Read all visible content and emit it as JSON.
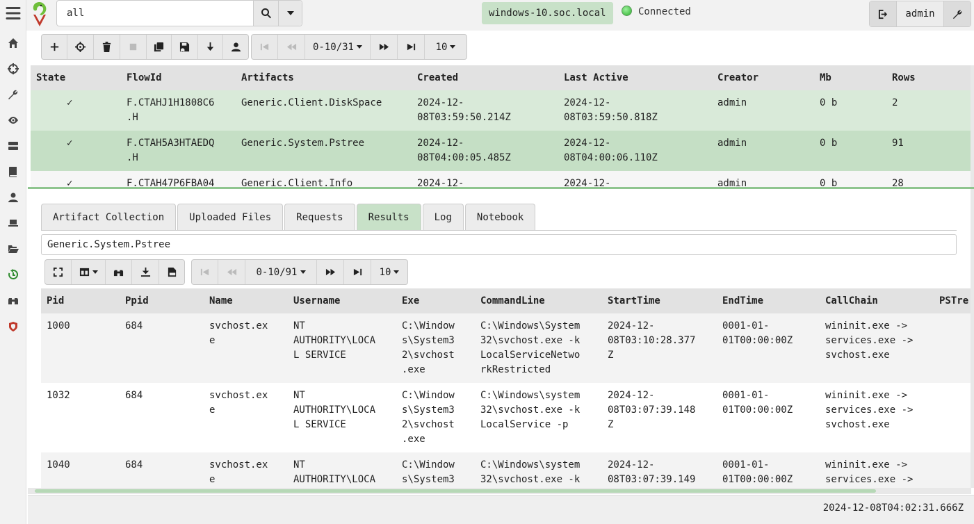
{
  "sidebar": {
    "icons": [
      "hamburger-icon",
      "home-icon",
      "crosshair-icon",
      "wrench-icon",
      "eye-icon",
      "server-icon",
      "book-icon",
      "user-icon",
      "laptop-icon",
      "folder-open-icon",
      "history-icon",
      "binoculars-icon",
      "velociraptor-shield-icon"
    ]
  },
  "header": {
    "search_value": "all",
    "host": "windows-10.soc.local",
    "connection_status": "Connected",
    "user": "admin"
  },
  "flows_toolbar": {
    "page_range": "0-10/31",
    "page_size": "10"
  },
  "flows": {
    "columns": [
      "State",
      "FlowId",
      "Artifacts",
      "Created",
      "Last Active",
      "Creator",
      "Mb",
      "Rows"
    ],
    "rows": [
      {
        "state": "✓",
        "flow_id": "F.CTAHJ1H1808C6\n.H",
        "artifacts": "Generic.Client.DiskSpace",
        "created": "2024-12-\n08T03:59:50.214Z",
        "last_active": "2024-12-\n08T03:59:50.818Z",
        "creator": "admin",
        "mb": "0 b",
        "rows": "2"
      },
      {
        "state": "✓",
        "flow_id": "F.CTAH5A3HTAEDQ\n.H",
        "artifacts": "Generic.System.Pstree",
        "created": "2024-12-\n08T04:00:05.485Z",
        "last_active": "2024-12-\n08T04:00:06.110Z",
        "creator": "admin",
        "mb": "0 b",
        "rows": "91"
      },
      {
        "state": "✓",
        "flow_id": "F.CTAH47P6FBA04",
        "artifacts": "Generic.Client.Info",
        "created": "2024-12-",
        "last_active": "2024-12-",
        "creator": "admin",
        "mb": "0 b",
        "rows": "28"
      }
    ]
  },
  "tabs": [
    "Artifact Collection",
    "Uploaded Files",
    "Requests",
    "Results",
    "Log",
    "Notebook"
  ],
  "active_tab": "Results",
  "artifact_name": "Generic.System.Pstree",
  "results_toolbar": {
    "page_range": "0-10/91",
    "page_size": "10"
  },
  "results": {
    "columns": [
      "Pid",
      "Ppid",
      "Name",
      "Username",
      "Exe",
      "CommandLine",
      "StartTime",
      "EndTime",
      "CallChain",
      "PSTre"
    ],
    "rows": [
      {
        "pid": "1000",
        "ppid": "684",
        "name": "svchost.ex\ne",
        "username": "NT\nAUTHORITY\\LOCA\nL SERVICE",
        "exe": "C:\\Window\ns\\System3\n2\\svchost\n.exe",
        "cmdline": "C:\\Windows\\System\n32\\svchost.exe -k\nLocalServiceNetwo\nrkRestricted",
        "start": "2024-12-\n08T03:10:28.377\nZ",
        "end": "0001-01-\n01T00:00:00Z",
        "chain": "wininit.exe ->\nservices.exe ->\nsvchost.exe"
      },
      {
        "pid": "1032",
        "ppid": "684",
        "name": "svchost.ex\ne",
        "username": "NT\nAUTHORITY\\LOCA\nL SERVICE",
        "exe": "C:\\Window\ns\\System3\n2\\svchost\n.exe",
        "cmdline": "C:\\Windows\\system\n32\\svchost.exe -k\nLocalService -p",
        "start": "2024-12-\n08T03:07:39.148\nZ",
        "end": "0001-01-\n01T00:00:00Z",
        "chain": "wininit.exe ->\nservices.exe ->\nsvchost.exe"
      },
      {
        "pid": "1040",
        "ppid": "684",
        "name": "svchost.ex\ne",
        "username": "NT\nAUTHORITY\\LOCA",
        "exe": "C:\\Window\ns\\System3",
        "cmdline": "C:\\Windows\\system\n32\\svchost.exe -k",
        "start": "2024-12-\n08T03:07:39.149",
        "end": "0001-01-\n01T00:00:00Z",
        "chain": "wininit.exe ->\nservices.exe ->"
      }
    ]
  },
  "footer": {
    "timestamp": "2024-12-08T04:02:31.666Z"
  }
}
